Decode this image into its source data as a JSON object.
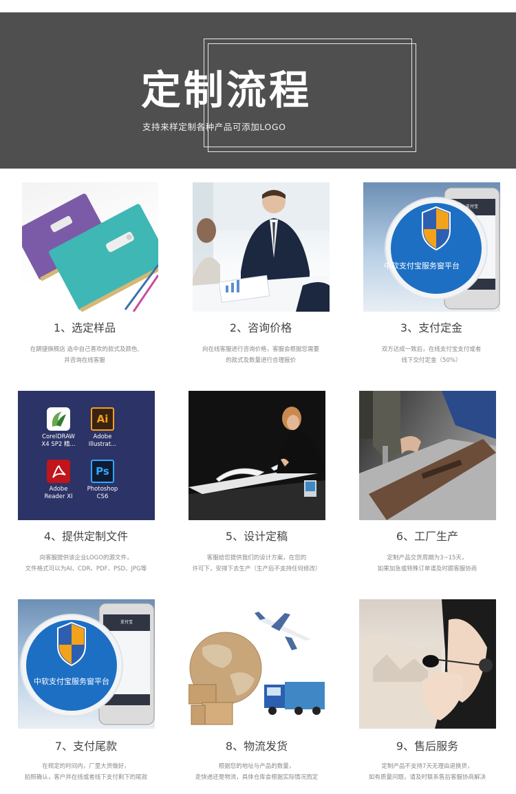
{
  "banner": {
    "title": "定制流程",
    "subtitle": "支持来样定制各种产品可添加LOGO"
  },
  "steps": [
    {
      "label": "1、选定样品",
      "desc1": "在朗捷旗舰店 选中自己喜欢的款式及颜色,",
      "desc2": "并咨询在线客服"
    },
    {
      "label": "2、咨询价格",
      "desc1": "向在线客服进行咨询价格，客服会根据您需要",
      "desc2": "的款式及数量进行合理报价"
    },
    {
      "label": "3、支付定金",
      "desc1": "双方达成一致后，在线支付宝支付或者",
      "desc2": "线下交付定金（50%）",
      "image_caption": "中软支付宝服务窗平台",
      "phone_title": "支付宝"
    },
    {
      "label": "4、提供定制文件",
      "desc1": "向客服提供该企业LOGO的源文件，",
      "desc2": "文件格式可以为AI、CDR、PDF、PSD、JPG等",
      "desktop_icons": [
        {
          "line1": "CorelDRAW",
          "line2": "X4 SP2 精...",
          "glyph": "corel-icon"
        },
        {
          "line1": "Adobe",
          "line2": "Illustrat...",
          "glyph": "Ai"
        },
        {
          "line1": "Adobe",
          "line2": "Reader XI",
          "glyph": "reader-icon"
        },
        {
          "line1": "Photoshop",
          "line2": "CS6",
          "glyph": "Ps"
        }
      ]
    },
    {
      "label": "5、设计定稿",
      "desc1": "客服给您提供我们的设计方案，在您的",
      "desc2": "许可下，安排下去生产（生产后不支持任何修改）"
    },
    {
      "label": "6、工厂生产",
      "desc1": "定制产品交货周期为3~15天，",
      "desc2": "如果加急或特殊订单请及时跟客服协商"
    },
    {
      "label": "7、支付尾款",
      "desc1": "在规定的时间内，厂里大货做好，",
      "desc2": "拍照确认，客户并在线或者线下支付剩下的尾款",
      "image_caption": "中软支付宝服务窗平台",
      "phone_title": "支付宝"
    },
    {
      "label": "8、物流发货",
      "desc1": "根据您的地址与产品的数量，",
      "desc2": "走快递还是物流，具体仓库会根据实际情况而定"
    },
    {
      "label": "9、售后服务",
      "desc1": "定制产品不支持7天无理由退换货，",
      "desc2": "如有质量问题，请及时联系售后客服协商解决"
    }
  ],
  "colors": {
    "banner_bg": "#4f4f4f",
    "alipay_blue": "#1d6fc4",
    "desktop_bg": "#2c3366"
  }
}
